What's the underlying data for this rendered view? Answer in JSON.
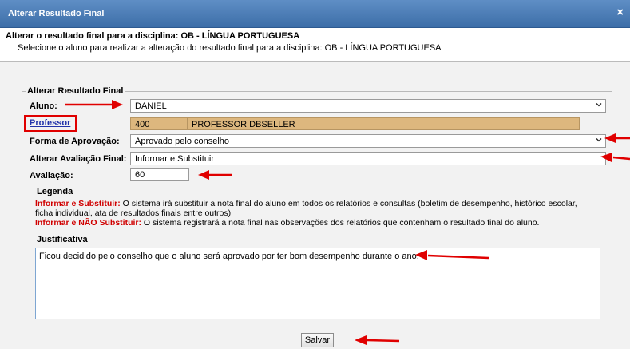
{
  "window": {
    "title": "Alterar Resultado Final",
    "close_icon": "×"
  },
  "header": {
    "title": "Alterar o resultado final para a disciplina: OB - LÍNGUA PORTUGUESA",
    "subtitle": "Selecione o aluno para realizar a alteração do resultado final para a disciplina: OB - LÍNGUA PORTUGUESA"
  },
  "form": {
    "legend": "Alterar Resultado Final",
    "aluno_label": "Aluno:",
    "aluno_value": "DANIEL",
    "professor_label": "Professor",
    "professor_code": "400",
    "professor_name": "PROFESSOR DBSELLER",
    "forma_label": "Forma de Aprovação:",
    "forma_value": "Aprovado pelo conselho",
    "alterar_label": "Alterar Avaliação Final:",
    "alterar_value": "Informar e Substituir",
    "avaliacao_label": "Avaliação:",
    "avaliacao_value": "60"
  },
  "legenda": {
    "title": "Legenda",
    "item1_key": "Informar e Substituir:",
    "item1_line1": " O sistema irá substituir a nota final do aluno em todos os relatórios e consultas (boletim de desempenho, histórico escolar,",
    "item1_line2": "ficha individual, ata de resultados finais entre outros)",
    "item2_key": "Informar e NÃO Substituir:",
    "item2_text": " O sistema registrará a nota final nas observações dos relatórios que contenham o resultado final do aluno."
  },
  "justificativa": {
    "title": "Justificativa",
    "text": "Ficou decidido pelo conselho que o aluno será aprovado por ter bom desempenho durante o ano."
  },
  "actions": {
    "save_label": "Salvar"
  },
  "colors": {
    "titlebar": "#4a7bb7",
    "annotation_red": "#e00000",
    "professor_field": "#ddb77e"
  }
}
